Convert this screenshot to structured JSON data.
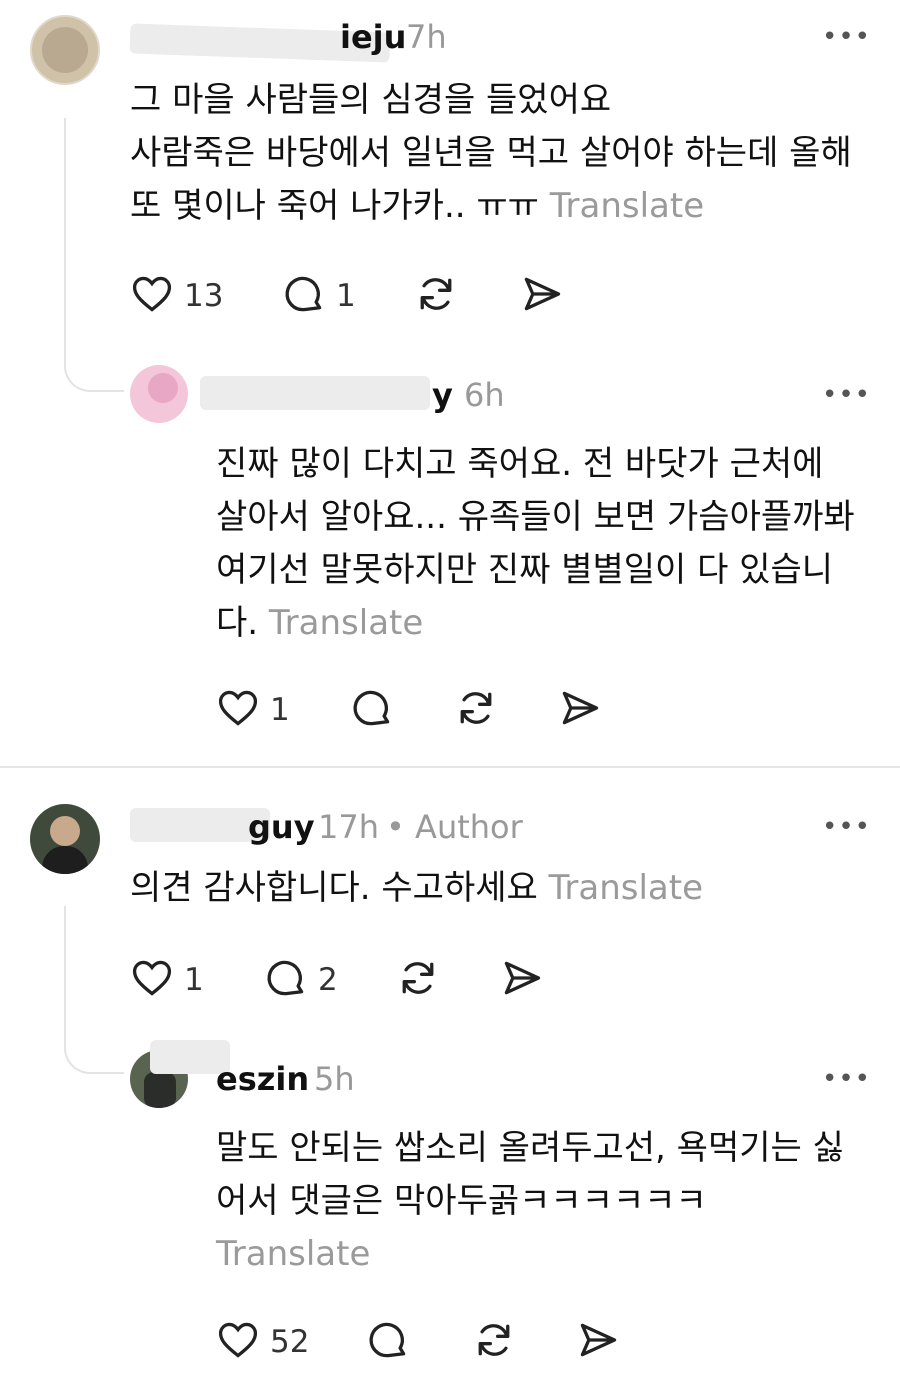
{
  "comments": [
    {
      "username": "ieju",
      "time": "7h",
      "more": "•••",
      "text_lines": [
        "그 마을 사람들의 심경을 들었어요",
        "사람죽은 바당에서 일년을 먹고 살어야 하는데 올해",
        "또 몇이나 죽어 나가카.. ㅠㅠ"
      ],
      "translate": "Translate",
      "likes": "13",
      "replies": "1",
      "colors": {
        "avatar": "#b9a990"
      }
    },
    {
      "username": "y",
      "time": "6h",
      "more": "•••",
      "text_lines": [
        "진짜 많이 다치고 죽어요. 전 바닷가 근처에",
        "살아서 알아요... 유족들이 보면 가슴아플까봐",
        "여기선 말못하지만 진짜 별별일이 다 있습니",
        "다."
      ],
      "translate": "Translate",
      "likes": "1",
      "colors": {
        "avatar": "#e9a7c6"
      }
    },
    {
      "username": "guy",
      "time": "17h",
      "author_tag": "• Author",
      "more": "•••",
      "text_lines": [
        "의견 감사합니다. 수고하세요"
      ],
      "translate": "Translate",
      "likes": "1",
      "replies": "2",
      "colors": {
        "avatar": "#5a6a56"
      }
    },
    {
      "username": "eszin",
      "time": "5h",
      "more": "•••",
      "text_lines": [
        "말도 안되는 쌉소리 올려두고선, 욕먹기는 싫",
        "어서 댓글은 막아두곩ㅋㅋㅋㅋㅋㅋ"
      ],
      "translate": "Translate",
      "likes": "52",
      "colors": {
        "avatar": "#6e7a6a"
      }
    }
  ],
  "icons": [
    "heart-icon",
    "comment-icon",
    "repost-icon",
    "share-icon",
    "more-icon"
  ]
}
